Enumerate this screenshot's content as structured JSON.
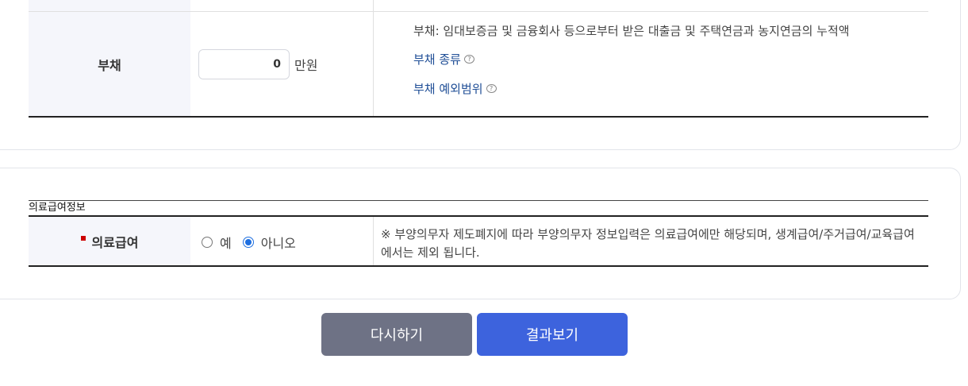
{
  "debt_section": {
    "label": "부채",
    "amount_value": "0",
    "unit": "만원",
    "description": "부채: 임대보증금 및 금융회사 등으로부터 받은 대출금 및 주택연금과 농지연금의 누적액",
    "link_types": "부채 종류",
    "link_exclusions": "부채 예외범위",
    "help_icon": "question-bubble-icon"
  },
  "medical_section": {
    "title": "의료급여정보",
    "label": "의료급여",
    "required_color": "#cc0000",
    "options": [
      {
        "label": "예",
        "checked": false
      },
      {
        "label": "아니오",
        "checked": true
      }
    ],
    "note": "※ 부양의무자 제도폐지에 따라 부양의무자 정보입력은 의료급여에만 해당되며, 생계급여/주거급여/교육급여에서는 제외 됩니다."
  },
  "buttons": {
    "reset": "다시하기",
    "result": "결과보기",
    "reset_color": "#6e7285",
    "result_color": "#3d63dd"
  },
  "colors": {
    "link": "#1f4e96",
    "label_bg": "#f5f6fb",
    "radio_accent": "#1e6fe0"
  }
}
